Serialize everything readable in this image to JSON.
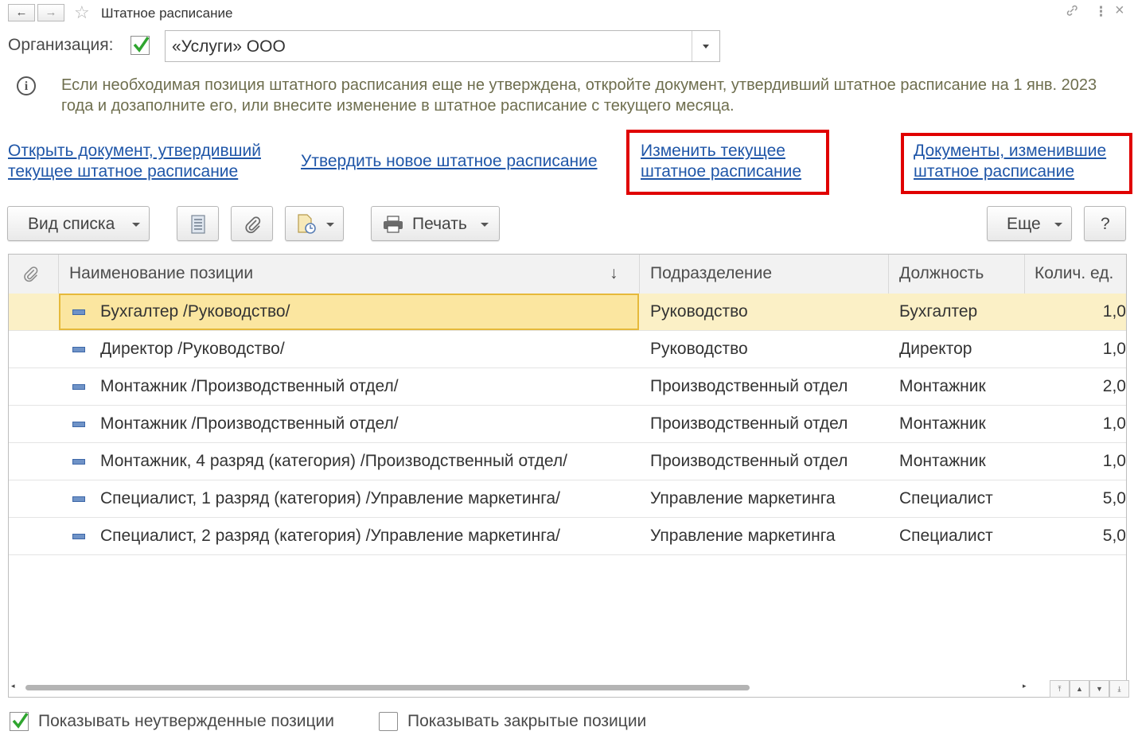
{
  "window": {
    "title": "Штатное расписание",
    "back_icon": "←",
    "forward_icon": "→",
    "favorite_icon": "☆",
    "link_icon": "🔗",
    "menu_icon": "⋮",
    "close_icon": "×"
  },
  "org": {
    "label": "Организация:",
    "checked": true,
    "value": "«Услуги» ООО"
  },
  "info": {
    "text": "Если необходимая позиция штатного расписания еще не утверждена, откройте документ, утвердивший штатное расписание на 1 янв. 2023 года и дозаполните его, или внесите изменение в штатное расписание с текущего месяца."
  },
  "links": {
    "open_doc_line1": "Открыть документ, утвердивший",
    "open_doc_line2": "текущее штатное расписание",
    "approve_new": "Утвердить новое штатное расписание",
    "change_line1": "Изменить текущее",
    "change_line2": "штатное расписание",
    "docs_line1": "Документы, изменившие",
    "docs_line2": "штатное расписание"
  },
  "toolbar": {
    "view_list": "Вид списка",
    "print": "Печать",
    "more": "Еще",
    "help": "?"
  },
  "table": {
    "columns": [
      "Наименование позиции",
      "Подразделение",
      "Должность",
      "Колич. ед."
    ],
    "sort_indicator": "↓",
    "rows": [
      {
        "name": "Бухгалтер /Руководство/",
        "dept": "Руководство",
        "position": "Бухгалтер",
        "qty": "1,0"
      },
      {
        "name": "Директор /Руководство/",
        "dept": "Руководство",
        "position": "Директор",
        "qty": "1,0"
      },
      {
        "name": "Монтажник /Производственный отдел/",
        "dept": "Производственный отдел",
        "position": "Монтажник",
        "qty": "2,0"
      },
      {
        "name": "Монтажник /Производственный отдел/",
        "dept": "Производственный отдел",
        "position": "Монтажник",
        "qty": "1,0"
      },
      {
        "name": "Монтажник, 4 разряд (категория) /Производственный отдел/",
        "dept": "Производственный отдел",
        "position": "Монтажник",
        "qty": "1,0"
      },
      {
        "name": "Специалист, 1 разряд (категория) /Управление маркетинга/",
        "dept": "Управление маркетинга",
        "position": "Специалист",
        "qty": "5,0"
      },
      {
        "name": "Специалист, 2 разряд (категория) /Управление маркетинга/",
        "dept": "Управление маркетинга",
        "position": "Специалист",
        "qty": "5,0"
      }
    ]
  },
  "footer": {
    "show_unapproved": "Показывать неутвержденные позиции",
    "show_unapproved_checked": true,
    "show_closed": "Показывать закрытые позиции",
    "show_closed_checked": false
  },
  "colors": {
    "link": "#1f56a8",
    "highlight_box": "#e00000",
    "selected_row": "#fbf0c6",
    "check_green": "#2fa52f"
  }
}
